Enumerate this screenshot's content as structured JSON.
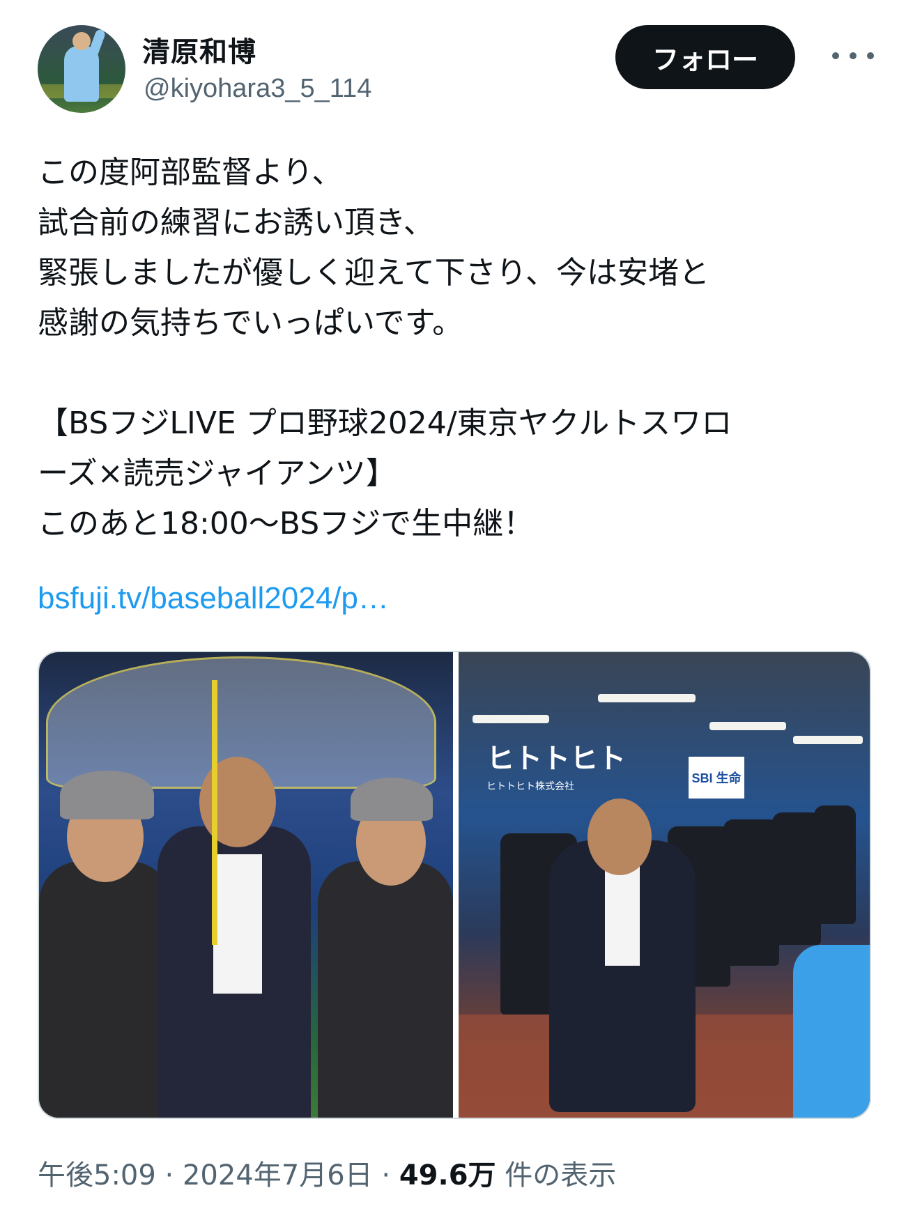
{
  "author": {
    "name": "清原和博",
    "handle": "@kiyohara3_5_114",
    "avatar_icon": "avatar-photo"
  },
  "actions": {
    "follow_label": "フォロー",
    "more_icon": "more-icon"
  },
  "tweet": {
    "text": "この度阿部監督より、\n試合前の練習にお誘い頂き、\n緊張しましたが優しく迎えて下さり、今は安堵と\n感謝の気持ちでいっぱいです。\n\n【BSフジLIVE プロ野球2024/東京ヤクルトスワロ\nーズ×読売ジャイアンツ】\nこのあと18:00〜BSフジで生中継！",
    "link": "bsfuji.tv/baseball2024/p…"
  },
  "media": {
    "left_photo_alt": "photo-stadium-umbrella",
    "right_photo_alt": "photo-dugout",
    "right_banner": "ヒトトヒト",
    "right_banner_sub": "ヒトトヒト株式会社",
    "right_sign": "SBI 生命"
  },
  "meta": {
    "time": "午後5:09",
    "separator": " · ",
    "date": "2024年7月6日",
    "views_count": "49.6万",
    "views_label": " 件の表示"
  },
  "colors": {
    "text": "#0f1419",
    "secondary": "#536471",
    "link": "#1d9bf0",
    "button_bg": "#0f1419"
  }
}
